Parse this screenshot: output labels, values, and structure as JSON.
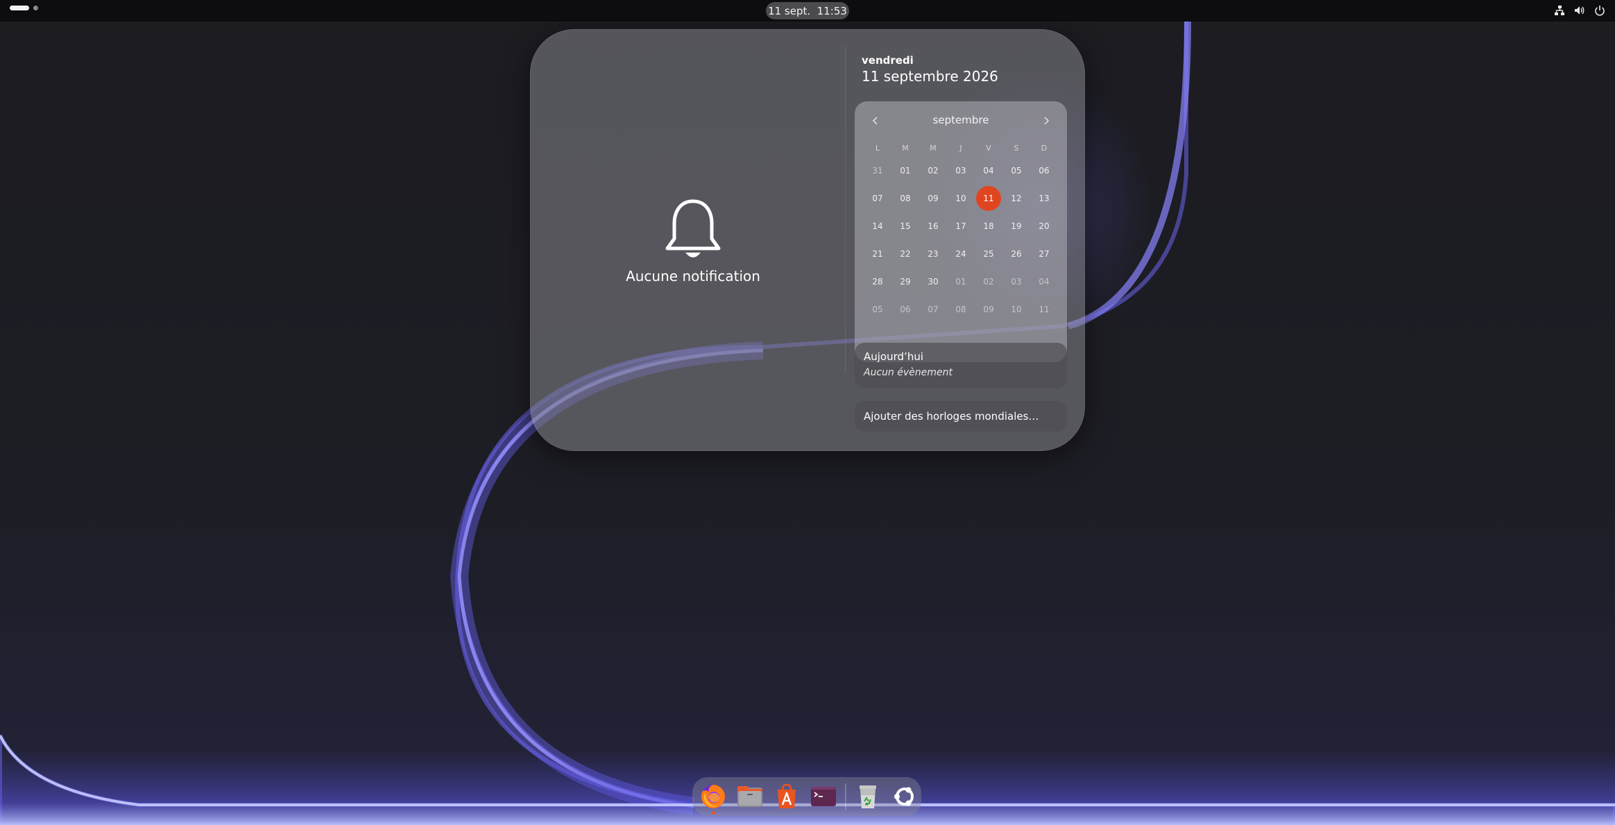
{
  "topbar": {
    "clock": "11 sept.  11:53",
    "tray_icons": [
      "network-icon",
      "volume-icon",
      "power-icon"
    ]
  },
  "notifications": {
    "empty_icon": "bell-icon",
    "empty_text": "Aucune notification"
  },
  "date_header": {
    "weekday": "vendredi",
    "full_date": "11 septembre 2026"
  },
  "calendar": {
    "month": "septembre",
    "weekdays": [
      "L",
      "M",
      "M",
      "J",
      "V",
      "S",
      "D"
    ],
    "weeks": [
      [
        "31",
        "01",
        "02",
        "03",
        "04",
        "05",
        "06"
      ],
      [
        "07",
        "08",
        "09",
        "10",
        "11",
        "12",
        "13"
      ],
      [
        "14",
        "15",
        "16",
        "17",
        "18",
        "19",
        "20"
      ],
      [
        "21",
        "22",
        "23",
        "24",
        "25",
        "26",
        "27"
      ],
      [
        "28",
        "29",
        "30",
        "01",
        "02",
        "03",
        "04"
      ],
      [
        "05",
        "06",
        "07",
        "08",
        "09",
        "10",
        "11"
      ]
    ],
    "today": "11",
    "accent_color": "#e0451f"
  },
  "events": {
    "title": "Aujourd’hui",
    "empty": "Aucun évènement"
  },
  "world_clocks": {
    "label": "Ajouter des horloges mondiales…"
  },
  "dock": {
    "apps": [
      "firefox-icon",
      "files-icon",
      "app-center-icon",
      "terminal-icon"
    ],
    "trash": "trash-icon",
    "show_apps": "show-apps-icon",
    "running_indicator_color": "#e8542b"
  }
}
